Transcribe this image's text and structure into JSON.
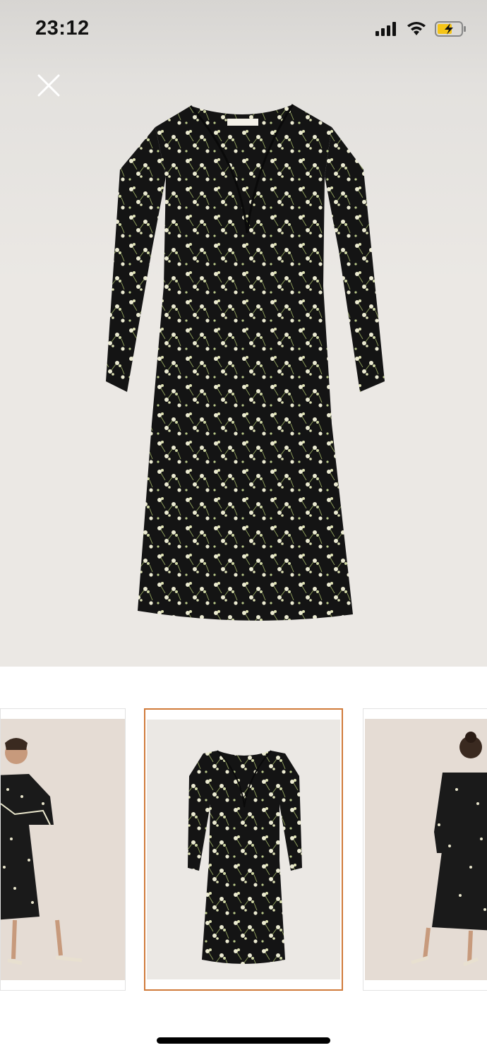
{
  "status_bar": {
    "time": "23:12",
    "icons": [
      "cellular-signal-icon",
      "wifi-icon",
      "battery-charging-icon"
    ],
    "battery_color": "#f5c518"
  },
  "header": {
    "close_icon": "close-icon"
  },
  "gallery": {
    "main_image": "floral-midi-dress-flat-lay",
    "thumbnails": [
      {
        "name": "model-front-view",
        "selected": false
      },
      {
        "name": "dress-flat-lay",
        "selected": true
      },
      {
        "name": "model-back-view",
        "selected": false
      }
    ],
    "selected_border_color": "#d07a3a"
  }
}
